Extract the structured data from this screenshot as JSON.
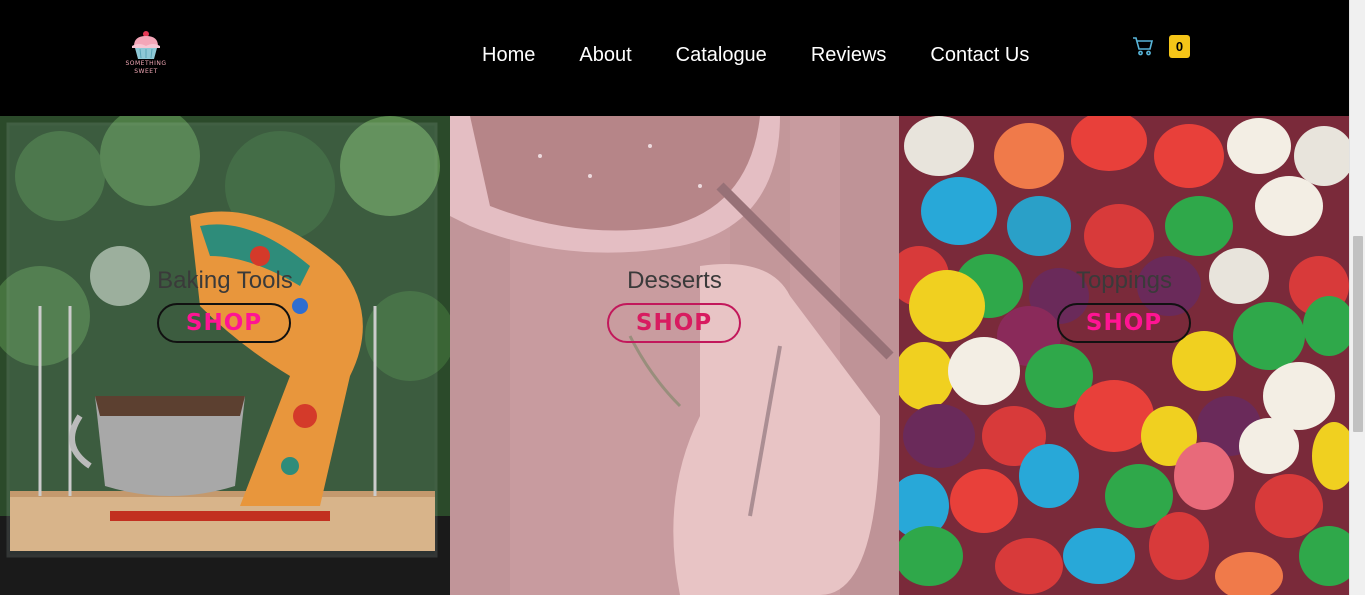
{
  "header": {
    "logo_text_line1": "SOMETHING",
    "logo_text_line2": "SWEET",
    "nav": [
      "Home",
      "About",
      "Catalogue",
      "Reviews",
      "Contact Us"
    ],
    "cart_count": "0"
  },
  "categories": [
    {
      "title": "Baking Tools",
      "button": "SHOP"
    },
    {
      "title": "Desserts",
      "button": "SHOP"
    },
    {
      "title": "Toppings",
      "button": "SHOP"
    }
  ],
  "colors": {
    "header_bg": "#000000",
    "badge": "#f5c518",
    "shop_text": "#ff1493",
    "dessert_overlay": "#e8b4bc"
  },
  "icons": [
    "cupcake-logo-icon",
    "cart-icon"
  ]
}
